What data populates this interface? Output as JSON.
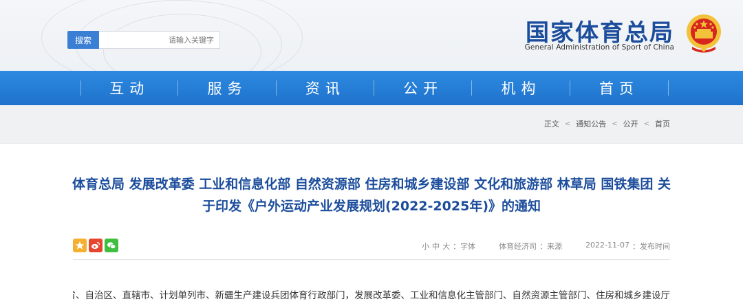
{
  "header": {
    "brand_title": "国家体育总局",
    "brand_subtitle": "General Administration of Sport of China",
    "search": {
      "button_label": "搜索",
      "placeholder": "请输入关键字"
    }
  },
  "nav": {
    "items": [
      {
        "label": "首页"
      },
      {
        "label": "机构"
      },
      {
        "label": "公开"
      },
      {
        "label": "资讯"
      },
      {
        "label": "服务"
      },
      {
        "label": "互动"
      }
    ]
  },
  "breadcrumb": {
    "items": [
      "首页",
      "公开",
      "通知公告",
      "正文"
    ],
    "separator": ">"
  },
  "article": {
    "title_line1": "体育总局 发展改革委 工业和信息化部 自然资源部 住房和城乡建设部 文化和旅游部 林草局 国铁集团 关",
    "title_line2": "于印发《户外运动产业发展规划(2022-2025年)》的通知",
    "meta": {
      "date_label": "发布时间：",
      "date_value": "2022-11-07",
      "source_label": "来源：",
      "source_value": "体育经济司",
      "font_label": "字体：",
      "font_options": [
        "大",
        "中",
        "小"
      ]
    },
    "body_first_line": "各省、自治区、直辖市、计划单列市、新疆生产建设兵团体育行政部门，发展改革委、工业和信息化主管部门、自然资源主管部门、住房和城乡建设厅",
    "share": {
      "icons": [
        "wechat-share-icon",
        "weibo-share-icon",
        "qzone-share-icon"
      ]
    }
  },
  "colors": {
    "brand_blue": "#1c4d9c",
    "nav_blue": "#2a84dc",
    "search_button": "#3b7fd4",
    "emblem_red": "#d7261e",
    "emblem_gold": "#f3c23b"
  }
}
